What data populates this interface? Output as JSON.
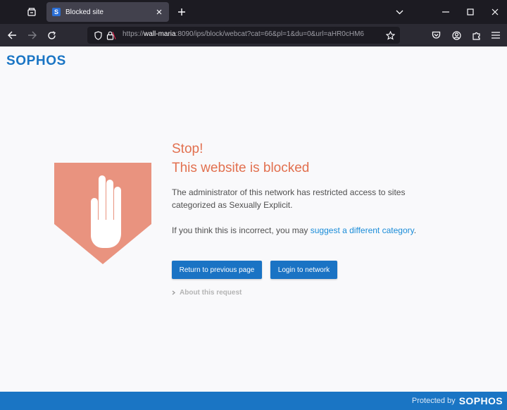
{
  "browser": {
    "tab": {
      "favicon_letter": "S",
      "title": "Blocked site"
    },
    "url": {
      "scheme": "https://",
      "host": "wall-maria",
      "rest": ":8090/ips/block/webcat?cat=66&pl=1&du=0&url=aHR0cHM6"
    }
  },
  "page": {
    "logo": "SOPHOS",
    "title_line1": "Stop!",
    "title_line2": "This website is blocked",
    "message": "The administrator of this network has restricted access to sites categorized as Sexually Explicit.",
    "incorrect_prefix": "If you think this is incorrect, you may ",
    "suggest_link": "suggest a different category",
    "incorrect_suffix": ".",
    "btn_previous": "Return to previous page",
    "btn_login": "Login to network",
    "about": "About this request"
  },
  "footer": {
    "protected_by": "Protected by",
    "logo": "SOPHOS"
  },
  "colors": {
    "accent": "#1a75c4",
    "alert": "#e2704f",
    "shield": "#e9937f"
  }
}
